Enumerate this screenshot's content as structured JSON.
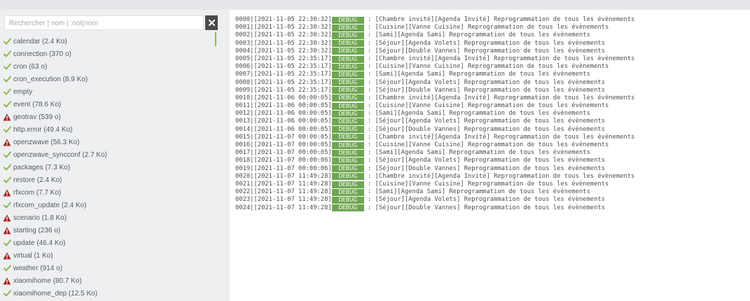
{
  "search": {
    "placeholder": "Rechercher | nom | :not(nom",
    "value": ""
  },
  "colors": {
    "ok": "#8dbb4d",
    "warn": "#a32626",
    "badge": "#6ea651",
    "clear_button": "#4b4b4b"
  },
  "files": [
    {
      "label": "calendar (2.4 Ko)",
      "status": "ok"
    },
    {
      "label": "connection (370 o)",
      "status": "ok"
    },
    {
      "label": "cron (63 o)",
      "status": "ok"
    },
    {
      "label": "cron_execution (8.9 Ko)",
      "status": "ok"
    },
    {
      "label": "empty",
      "status": "ok"
    },
    {
      "label": "event (78.6 Ko)",
      "status": "ok"
    },
    {
      "label": "geotrav (539 o)",
      "status": "warn"
    },
    {
      "label": "http.error (49.4 Ko)",
      "status": "ok"
    },
    {
      "label": "openzwave (56.3 Ko)",
      "status": "warn"
    },
    {
      "label": "openzwave_syncconf (2.7 Ko)",
      "status": "ok"
    },
    {
      "label": "packages (7.3 Ko)",
      "status": "ok"
    },
    {
      "label": "restore (2.4 Ko)",
      "status": "ok"
    },
    {
      "label": "rfxcom (7.7 Ko)",
      "status": "warn"
    },
    {
      "label": "rfxcom_update (2.4 Ko)",
      "status": "ok"
    },
    {
      "label": "scenario (1.8 Ko)",
      "status": "warn"
    },
    {
      "label": "starting (236 o)",
      "status": "warn"
    },
    {
      "label": "update (46.4 Ko)",
      "status": "ok"
    },
    {
      "label": "virtual (1 Ko)",
      "status": "warn"
    },
    {
      "label": "weather (914 o)",
      "status": "ok"
    },
    {
      "label": "xiaomihome (80.7 Ko)",
      "status": "warn"
    },
    {
      "label": "xiaomihome_dep (12.5 Ko)",
      "status": "ok"
    }
  ],
  "log": {
    "level": "DEBUG",
    "lines": [
      {
        "prefix": "0000|[2021-11-05 22:30:32]",
        "msg": " : [Chambre invité][Agenda Invité] Reprogrammation de tous les évènements"
      },
      {
        "prefix": "0001|[2021-11-05 22:30:32]",
        "msg": " : [Cuisine][Vanne Cuisine] Reprogrammation de tous les évènements"
      },
      {
        "prefix": "0002|[2021-11-05 22:30:32]",
        "msg": " : [Sami][Agenda Sami] Reprogrammation de tous les évènements"
      },
      {
        "prefix": "0003|[2021-11-05 22:30:32]",
        "msg": " : [Séjour][Agenda Volets] Reprogrammation de tous les évènements"
      },
      {
        "prefix": "0004|[2021-11-05 22:30:32]",
        "msg": " : [Séjour][Double Vannes] Reprogrammation de tous les évènements"
      },
      {
        "prefix": "0005|[2021-11-05 22:35:17]",
        "msg": " : [Chambre invité][Agenda Invité] Reprogrammation de tous les évènements"
      },
      {
        "prefix": "0006|[2021-11-05 22:35:17]",
        "msg": " : [Cuisine][Vanne Cuisine] Reprogrammation de tous les évènements"
      },
      {
        "prefix": "0007|[2021-11-05 22:35:17]",
        "msg": " : [Sami][Agenda Sami] Reprogrammation de tous les évènements"
      },
      {
        "prefix": "0008|[2021-11-05 22:35:17]",
        "msg": " : [Séjour][Agenda Volets] Reprogrammation de tous les évènements"
      },
      {
        "prefix": "0009|[2021-11-05 22:35:17]",
        "msg": " : [Séjour][Double Vannes] Reprogrammation de tous les évènements"
      },
      {
        "prefix": "0010|[2021-11-06 00:00:05]",
        "msg": " : [Chambre invité][Agenda Invité] Reprogrammation de tous les évènements"
      },
      {
        "prefix": "0011|[2021-11-06 00:00:05]",
        "msg": " : [Cuisine][Vanne Cuisine] Reprogrammation de tous les évènements"
      },
      {
        "prefix": "0012|[2021-11-06 00:00:05]",
        "msg": " : [Sami][Agenda Sami] Reprogrammation de tous les évènements"
      },
      {
        "prefix": "0013|[2021-11-06 00:00:05]",
        "msg": " : [Séjour][Agenda Volets] Reprogrammation de tous les évènements"
      },
      {
        "prefix": "0014|[2021-11-06 00:00:05]",
        "msg": " : [Séjour][Double Vannes] Reprogrammation de tous les évènements"
      },
      {
        "prefix": "0015|[2021-11-07 00:00:05]",
        "msg": " : [Chambre invité][Agenda Invité] Reprogrammation de tous les évènements"
      },
      {
        "prefix": "0016|[2021-11-07 00:00:05]",
        "msg": " : [Cuisine][Vanne Cuisine] Reprogrammation de tous les évènements"
      },
      {
        "prefix": "0017|[2021-11-07 00:00:05]",
        "msg": " : [Sami][Agenda Sami] Reprogrammation de tous les évènements"
      },
      {
        "prefix": "0018|[2021-11-07 00:00:06]",
        "msg": " : [Séjour][Agenda Volets] Reprogrammation de tous les évènements"
      },
      {
        "prefix": "0019|[2021-11-07 00:00:06]",
        "msg": " : [Séjour][Double Vannes] Reprogrammation de tous les évènements"
      },
      {
        "prefix": "0020|[2021-11-07 11:49:28]",
        "msg": " : [Chambre invité][Agenda Invité] Reprogrammation de tous les évènements"
      },
      {
        "prefix": "0021|[2021-11-07 11:49:28]",
        "msg": " : [Cuisine][Vanne Cuisine] Reprogrammation de tous les évènements"
      },
      {
        "prefix": "0022|[2021-11-07 11:49:28]",
        "msg": " : [Sami][Agenda Sami] Reprogrammation de tous les évènements"
      },
      {
        "prefix": "0023|[2021-11-07 11:49:28]",
        "msg": " : [Séjour][Agenda Volets] Reprogrammation de tous les évènements"
      },
      {
        "prefix": "0024|[2021-11-07 11:49:28]",
        "msg": " : [Séjour][Double Vannes] Reprogrammation de tous les évènements"
      }
    ]
  }
}
